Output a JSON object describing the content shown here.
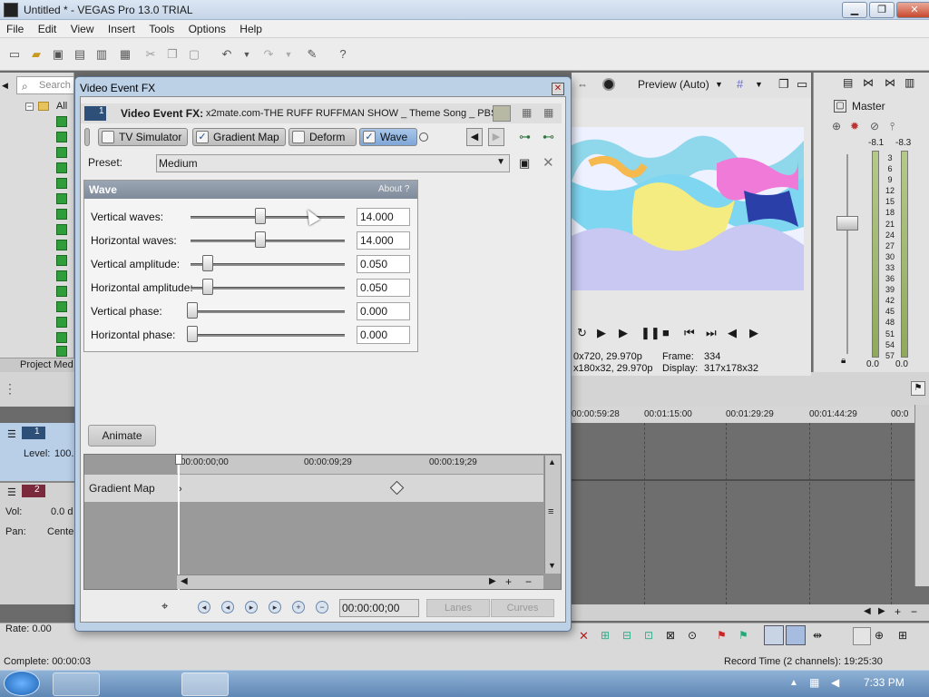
{
  "window": {
    "title": "Untitled * - VEGAS Pro 13.0 TRIAL",
    "minimize": "▁",
    "maximize": "❐",
    "close": "✕"
  },
  "menu": [
    "File",
    "Edit",
    "View",
    "Insert",
    "Tools",
    "Options",
    "Help"
  ],
  "explorer": {
    "search_placeholder": "Search",
    "tree_root": "All",
    "tab": "Project Med"
  },
  "preview": {
    "mode": "Preview (Auto)",
    "info_line1_left": "0x720, 29.970p",
    "info_line1_right_label": "Frame:",
    "info_line1_right_value": "334",
    "info_line2_left": "x180x32, 29.970p",
    "info_line2_right_label": "Display:",
    "info_line2_right_value": "317x178x32"
  },
  "master": {
    "label": "Master",
    "peak_left": "-8.1",
    "peak_right": "-8.3",
    "scale": [
      "3",
      "6",
      "9",
      "12",
      "15",
      "18",
      "21",
      "24",
      "27",
      "30",
      "33",
      "36",
      "39",
      "42",
      "45",
      "48",
      "51",
      "54",
      "57"
    ],
    "bottom_left": "0.0",
    "bottom_right": "0.0"
  },
  "timeline": {
    "ruler": [
      "00:00:59:28",
      "00:01:15:00",
      "00:01:29:29",
      "00:01:44:29",
      "00:0"
    ]
  },
  "tracks": [
    {
      "number": "1",
      "field1_label": "Level:",
      "field1_value": "100."
    },
    {
      "number": "2",
      "field1_label": "Vol:",
      "field1_value": "0.0 d",
      "field2_label": "Pan:",
      "field2_value": "Cente"
    }
  ],
  "status": {
    "rate": "Rate: 0.00",
    "complete": "Complete: 00:00:03",
    "record_time": "Record Time (2 channels): 19:25:30"
  },
  "taskbar": {
    "clock": "7:33 PM"
  },
  "dialog": {
    "title": "Video Event FX",
    "track_no": "1",
    "header_label": "Video Event FX:",
    "header_clip": "x2mate.com-THE RUFF RUFFMAN SHOW _ Theme Song _ PBS",
    "chain": [
      {
        "label": "TV Simulator",
        "checked": ""
      },
      {
        "label": "Gradient Map",
        "checked": "✓"
      },
      {
        "label": "Deform",
        "checked": ""
      },
      {
        "label": "Wave",
        "checked": "✓"
      }
    ],
    "preset_label": "Preset:",
    "preset_value": "Medium",
    "panel_title": "Wave",
    "panel_about": "About  ?",
    "params": [
      {
        "label": "Vertical waves:",
        "value": "14.000",
        "fraction": 0.44
      },
      {
        "label": "Horizontal waves:",
        "value": "14.000",
        "fraction": 0.44
      },
      {
        "label": "Vertical amplitude:",
        "value": "0.050",
        "fraction": 0.1
      },
      {
        "label": "Horizontal amplitude:",
        "value": "0.050",
        "fraction": 0.1
      },
      {
        "label": "Vertical phase:",
        "value": "0.000",
        "fraction": 0.0
      },
      {
        "label": "Horizontal phase:",
        "value": "0.000",
        "fraction": 0.0
      }
    ],
    "animate_label": "Animate",
    "kf_ruler": [
      "00:00:00;00",
      "00:00:09;29",
      "00:00:19;29"
    ],
    "kf_row_label": "Gradient Map",
    "kf_time": "00:00:00;00",
    "tab_lanes": "Lanes",
    "tab_curves": "Curves"
  }
}
